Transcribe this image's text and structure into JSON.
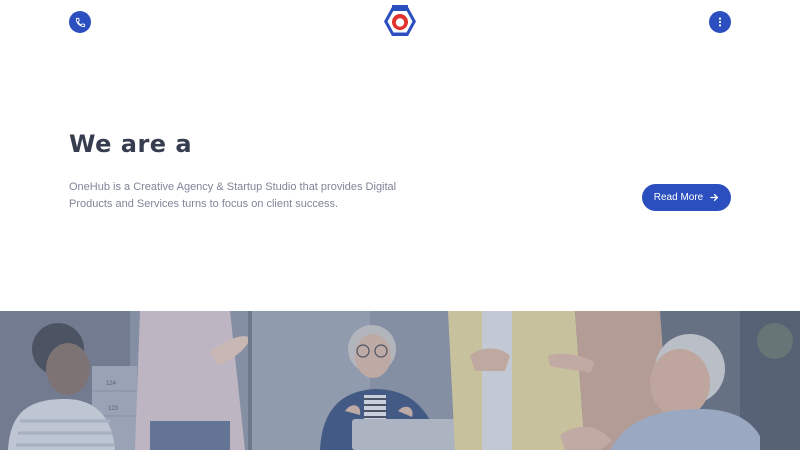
{
  "header": {
    "phone_icon": "phone-icon",
    "menu_icon": "kebab-menu-icon",
    "logo_icon": "hexagon-logo-icon",
    "colors": {
      "accent": "#2c4fbf",
      "logo_red": "#e0332f"
    }
  },
  "hero": {
    "title": "We are a",
    "description": "OneHub is a Creative Agency & Startup Studio that provides Digital Products and Services turns to focus on client success.",
    "cta_label": "Read More",
    "cta_icon": "arrow-right-icon",
    "colors": {
      "title": "#363d4f",
      "text": "#7e8597",
      "button": "#2c4fbf"
    }
  },
  "photo": {
    "subject": "team-meeting-photo",
    "labels": [
      "124",
      "123"
    ]
  }
}
